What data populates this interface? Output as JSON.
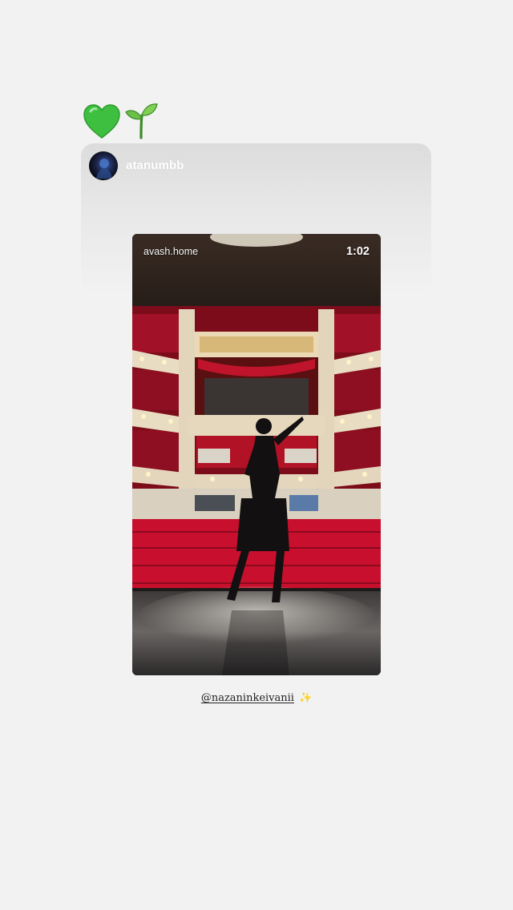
{
  "stickers": [
    {
      "icon": "green-heart-icon",
      "color": "#3fbf3f"
    },
    {
      "icon": "seedling-icon",
      "color": "#5cae3a"
    }
  ],
  "story": {
    "username": "atanumbb"
  },
  "video": {
    "account": "avash.home",
    "duration": "1:02"
  },
  "caption": {
    "mention": "@nazaninkeivanii",
    "emoji": "✨"
  },
  "colors": {
    "background": "#f2f2f2",
    "seat_red": "#c8102e",
    "balcony_red": "#9c0f22",
    "text_dark": "#222222"
  }
}
